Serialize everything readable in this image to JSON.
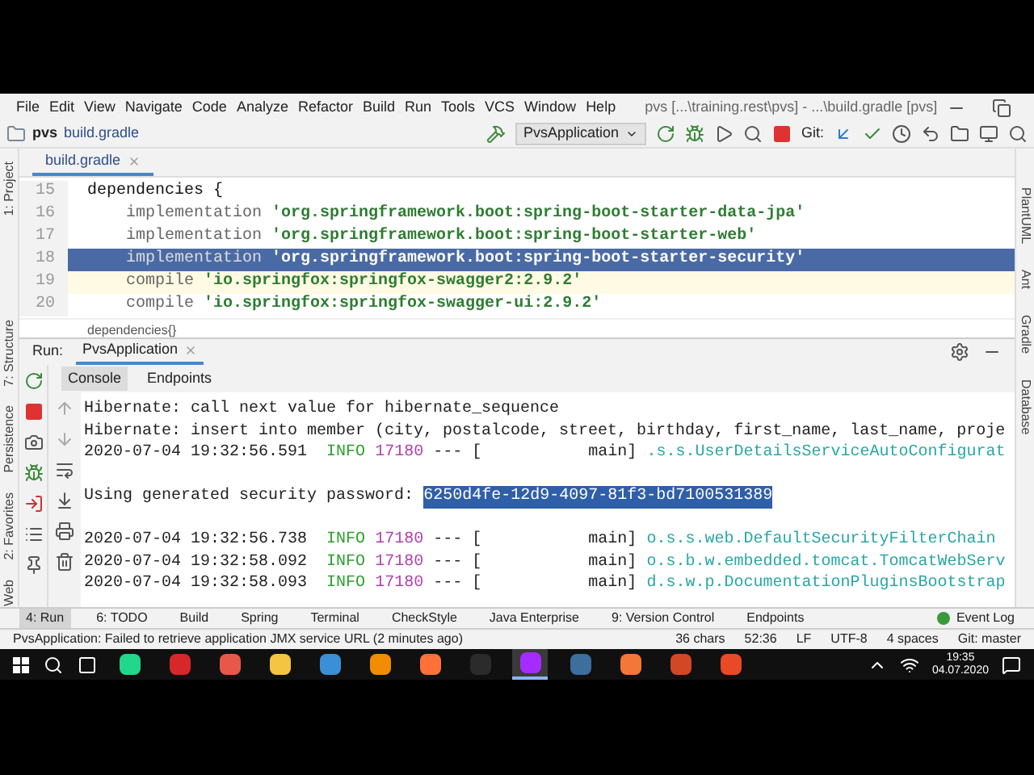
{
  "menu": [
    "File",
    "Edit",
    "View",
    "Navigate",
    "Code",
    "Analyze",
    "Refactor",
    "Build",
    "Run",
    "Tools",
    "VCS",
    "Window",
    "Help"
  ],
  "window": {
    "title": "pvs [...\\training.rest\\pvs] - ...\\build.gradle [pvs]"
  },
  "toolbar": {
    "breadcrumb": [
      "pvs",
      "build.gradle"
    ],
    "run_config": "PvsApplication",
    "git_label": "Git:"
  },
  "left_strip": [
    "1: Project",
    "7: Structure",
    "Persistence",
    "2: Favorites",
    "Web"
  ],
  "right_strip": [
    "PlantUML",
    "Ant",
    "Gradle",
    "Database"
  ],
  "editor_tabs": [
    {
      "label": "build.gradle",
      "selected": true
    }
  ],
  "code": [
    {
      "number": "15",
      "kind": "block",
      "text": "dependencies {",
      "selected": false,
      "caret_line": false
    },
    {
      "number": "16",
      "kind": "call",
      "text": "implementation",
      "string": "'org.springframework.boot:spring-boot-starter-data-jpa'",
      "selected": false,
      "caret_line": false
    },
    {
      "number": "17",
      "kind": "call",
      "text": "implementation",
      "string": "'org.springframework.boot:spring-boot-starter-web'",
      "selected": false,
      "caret_line": false
    },
    {
      "number": "18",
      "kind": "call",
      "text": "implementation",
      "string": "'org.springframework.boot:spring-boot-starter-security'",
      "selected": true,
      "caret_line": false
    },
    {
      "number": "19",
      "kind": "call",
      "text": "compile",
      "string": "'io.springfox:springfox-swagger2:2.9.2'",
      "selected": false,
      "caret_line": true
    },
    {
      "number": "20",
      "kind": "call",
      "text": "compile",
      "string": "'io.springfox:springfox-swagger-ui:2.9.2'",
      "selected": false,
      "caret_line": false
    }
  ],
  "breadcrumb_footer": "dependencies{}",
  "run_panel": {
    "label": "Run:",
    "config": "PvsApplication",
    "tabs": [
      {
        "label": "Console",
        "selected": true
      },
      {
        "label": "Endpoints",
        "selected": false
      }
    ]
  },
  "console": [
    {
      "kind": "plain",
      "text": "Hibernate: call next value for hibernate_sequence"
    },
    {
      "kind": "plain",
      "text": "Hibernate: insert into member (city, postalcode, street, birthday, first_name, last_name, proje"
    },
    {
      "kind": "log",
      "timestamp": "2020-07-04 19:32:56.591",
      "level": "INFO",
      "pid": "17180",
      "sep": "---",
      "thread": "[           main]",
      "logger": ".s.s.UserDetailsServiceAutoConfigurat"
    },
    {
      "kind": "blank"
    },
    {
      "kind": "password",
      "text": "Using generated security password:",
      "value": "6250d4fe-12d9-4097-81f3-bd7100531389"
    },
    {
      "kind": "blank"
    },
    {
      "kind": "log",
      "timestamp": "2020-07-04 19:32:56.738",
      "level": "INFO",
      "pid": "17180",
      "sep": "---",
      "thread": "[           main]",
      "logger": "o.s.s.web.DefaultSecurityFilterChain"
    },
    {
      "kind": "log",
      "timestamp": "2020-07-04 19:32:58.092",
      "level": "INFO",
      "pid": "17180",
      "sep": "---",
      "thread": "[           main]",
      "logger": "o.s.b.w.embedded.tomcat.TomcatWebServ"
    },
    {
      "kind": "log",
      "timestamp": "2020-07-04 19:32:58.093",
      "level": "INFO",
      "pid": "17180",
      "sep": "---",
      "thread": "[           main]",
      "logger": "d.s.w.p.DocumentationPluginsBootstrap"
    }
  ],
  "tool_tabs": [
    {
      "label": "4: Run",
      "selected": true
    },
    {
      "label": "6: TODO",
      "selected": false
    },
    {
      "label": "Build",
      "selected": false
    },
    {
      "label": "Spring",
      "selected": false
    },
    {
      "label": "Terminal",
      "selected": false
    },
    {
      "label": "CheckStyle",
      "selected": false
    },
    {
      "label": "Java Enterprise",
      "selected": false
    },
    {
      "label": "9: Version Control",
      "selected": false
    },
    {
      "label": "Endpoints",
      "selected": false
    }
  ],
  "event_log": "Event Log",
  "status_bar": {
    "message": "PvsApplication: Failed to retrieve application JMX service URL (2 minutes ago)",
    "items": [
      "36 chars",
      "52:36",
      "LF",
      "UTF-8",
      "4 spaces",
      "Git: master"
    ]
  },
  "taskbar": {
    "apps": [
      {
        "color": "#21d789",
        "selected": false
      },
      {
        "color": "#d62828",
        "selected": false
      },
      {
        "color": "#e8584a",
        "selected": false
      },
      {
        "color": "#f4c542",
        "selected": false
      },
      {
        "color": "#3b8fd6",
        "selected": false
      },
      {
        "color": "#f28c00",
        "selected": false
      },
      {
        "color": "#ff7139",
        "selected": false
      },
      {
        "color": "#2b2b2b",
        "selected": false
      },
      {
        "color": "#a52bff",
        "selected": true
      },
      {
        "color": "#3c6e9e",
        "selected": false
      },
      {
        "color": "#f37736",
        "selected": false
      },
      {
        "color": "#d24726",
        "selected": false
      },
      {
        "color": "#e84a27",
        "selected": false
      }
    ],
    "time": "19:35",
    "date": "04.07.2020"
  }
}
